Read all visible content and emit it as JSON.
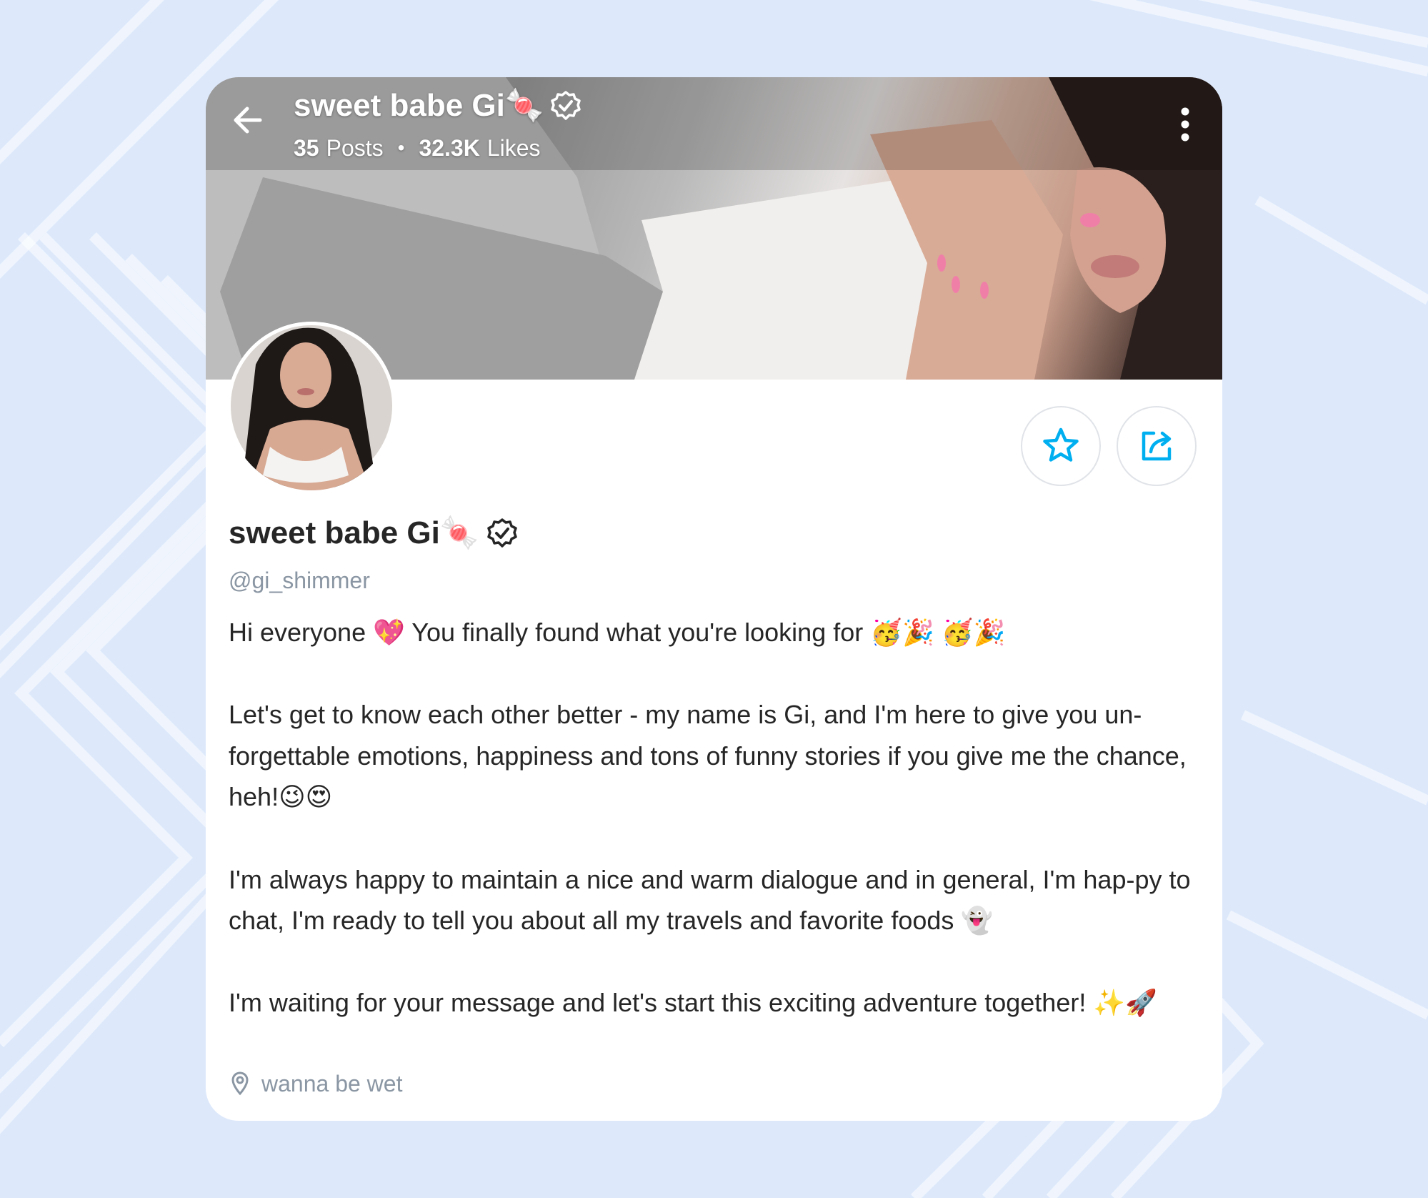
{
  "header": {
    "title": "sweet babe Gi🍬",
    "posts_count": "35",
    "posts_label": "Posts",
    "separator": "•",
    "likes_count": "32.3K",
    "likes_label": "Likes"
  },
  "profile": {
    "name": "sweet babe Gi🍬",
    "handle": "@gi_shimmer",
    "bio": "Hi everyone 💖 You finally found what you're looking for 🥳🎉 🥳🎉\n\nLet's get to know each other better - my name is Gi, and I'm here to give you un-forgettable emotions, happiness and tons of funny stories if you give me the chance, heh!😉😍\n\nI'm always happy to maintain a nice and warm dialogue and in general, I'm hap-py to chat, I'm ready to tell you about all my travels and favorite foods 👻\n\nI'm waiting for your message and let's start this exciting adventure together! ✨🚀",
    "location": "wanna be wet"
  },
  "icons": {
    "back": "arrow-left-icon",
    "verified": "verified-badge-icon",
    "more": "more-vertical-icon",
    "favorite": "star-icon",
    "share": "share-icon",
    "location": "map-pin-icon"
  },
  "colors": {
    "accent": "#00aff0",
    "background": "#dde9fb",
    "text": "#262626",
    "muted": "#8a96a3"
  }
}
